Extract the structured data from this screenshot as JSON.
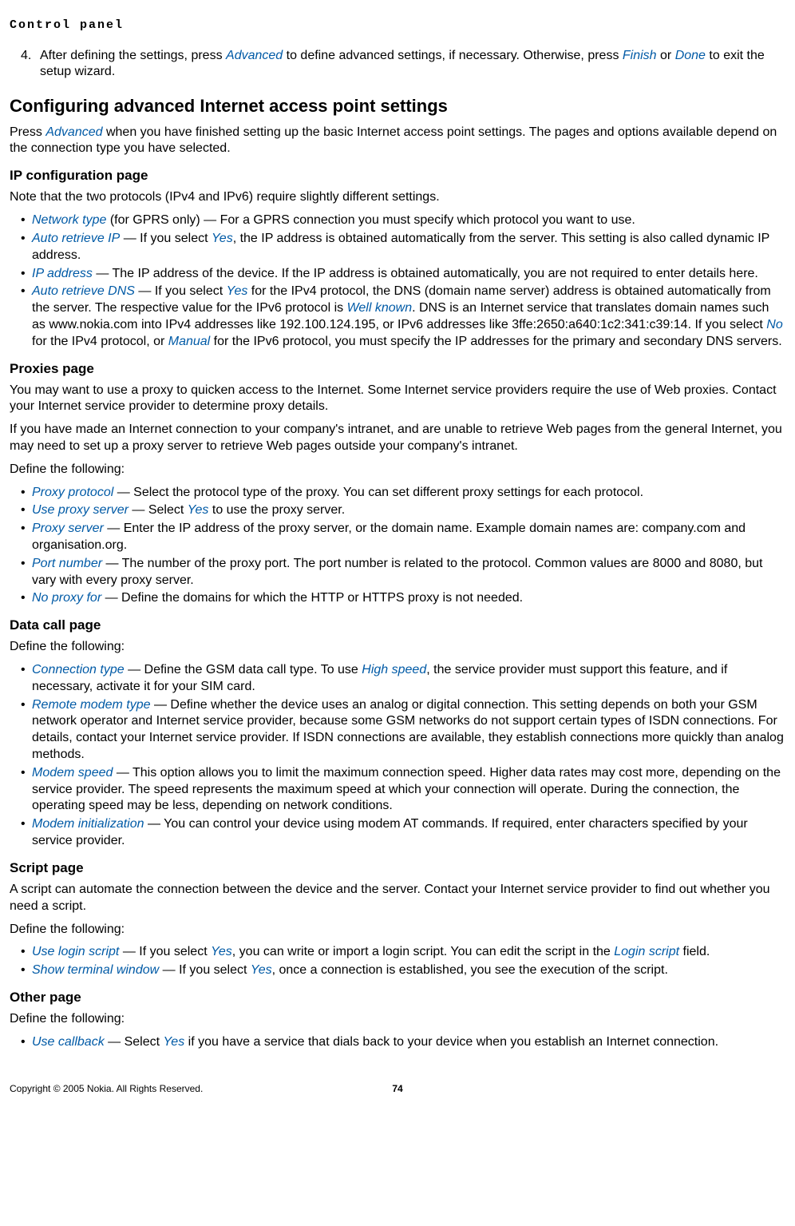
{
  "header": "Control panel",
  "step4": {
    "num": "4.",
    "t1": "After defining the settings, press ",
    "advanced": "Advanced",
    "t2": " to define advanced settings, if necessary. Otherwise, press ",
    "finish": "Finish",
    "t3": " or ",
    "done": "Done",
    "t4": " to exit the setup wizard."
  },
  "sec_config_title": "Configuring advanced Internet access point settings",
  "sec_config_intro": {
    "t1": "Press ",
    "advanced": "Advanced",
    "t2": " when you have finished setting up the basic Internet access point settings. The pages and options available depend on the connection type you have selected."
  },
  "ip_page_title": "IP configuration page",
  "ip_note": "Note that the two protocols (IPv4 and IPv6) require slightly different settings.",
  "ip_items": {
    "i1": {
      "label": "Network type",
      "text": " (for GPRS only) — For a GPRS connection you must specify which protocol you want to use."
    },
    "i2": {
      "label": "Auto retrieve IP",
      "t1": " — If you select ",
      "yes": "Yes",
      "t2": ", the IP address is obtained automatically from the server. This setting is also called dynamic IP address."
    },
    "i3": {
      "label": "IP address",
      "text": " — The IP address of the device. If the IP address is obtained automatically, you are not required to enter details here."
    },
    "i4": {
      "label": "Auto retrieve DNS",
      "t1": " — If you select ",
      "yes": "Yes",
      "t2": " for the IPv4 protocol, the DNS (domain name server) address is obtained automatically from the server. The respective value for the IPv6 protocol is ",
      "wellknown": "Well known",
      "t3": ". DNS is an Internet service that translates domain names such as www.nokia.com into IPv4 addresses like 192.100.124.195, or IPv6 addresses like 3ffe:2650:a640:1c2:341:c39:14. If you select ",
      "no": "No",
      "t4": " for the IPv4 protocol, or ",
      "manual": "Manual",
      "t5": " for the IPv6 protocol, you must specify the IP addresses for the primary and secondary DNS servers."
    }
  },
  "proxies_title": "Proxies page",
  "proxies_p1": "You may want to use a proxy to quicken access to the Internet. Some Internet service providers require the use of Web proxies. Contact your Internet service provider to determine proxy details.",
  "proxies_p2": "If you have made an Internet connection to your company's intranet, and are unable to retrieve Web pages from the general Internet, you may need to set up a proxy server to retrieve Web pages outside your company's intranet.",
  "define_following": "Define the following:",
  "prox_items": {
    "i1": {
      "label": "Proxy protocol",
      "text": " — Select the protocol type of the proxy. You can set different proxy settings for each protocol."
    },
    "i2": {
      "label": "Use proxy server",
      "t1": " — Select ",
      "yes": "Yes",
      "t2": " to use the proxy server."
    },
    "i3": {
      "label": "Proxy server",
      "text": " — Enter the IP address of the proxy server, or the domain name. Example domain names are: company.com and organisation.org."
    },
    "i4": {
      "label": "Port number",
      "text": " — The number of the proxy port. The port number is related to the protocol. Common values are 8000 and 8080, but vary with every proxy server."
    },
    "i5": {
      "label": "No proxy for",
      "text": " — Define the domains for which the HTTP or HTTPS proxy is not needed."
    }
  },
  "datacall_title": "Data call page",
  "dc_items": {
    "i1": {
      "label": "Connection type",
      "t1": " — Define the GSM data call type. To use ",
      "hs": "High speed",
      "t2": ", the service provider must support this feature, and if necessary, activate it for your SIM card."
    },
    "i2": {
      "label": "Remote modem type",
      "text": " — Define whether the device uses an analog or digital connection. This setting depends on both your GSM network operator and Internet service provider, because some GSM networks do not support certain types of ISDN connections. For details, contact your Internet service provider. If ISDN connections are available, they establish connections more quickly than analog methods."
    },
    "i3": {
      "label": "Modem speed",
      "text": " — This option allows you to limit the maximum connection speed. Higher data rates may cost more, depending on the service provider. The speed represents the maximum speed at which your connection will operate. During the connection, the operating speed may be less, depending on network conditions."
    },
    "i4": {
      "label": "Modem initialization",
      "text": " — You can control your device using modem AT commands. If required, enter characters specified by your service provider."
    }
  },
  "script_title": "Script page",
  "script_p1": "A script can automate the connection between the device and the server. Contact your Internet service provider to find out whether you need a script.",
  "script_items": {
    "i1": {
      "label": "Use login script",
      "t1": " — If you select ",
      "yes": "Yes",
      "t2": ", you can write or import a login script. You can edit the script in the ",
      "login": "Login script",
      "t3": " field."
    },
    "i2": {
      "label": "Show terminal window",
      "t1": " — If you select ",
      "yes": "Yes",
      "t2": ", once a connection is established, you see the execution of the script."
    }
  },
  "other_title": "Other page",
  "other_items": {
    "i1": {
      "label": "Use callback",
      "t1": " — Select ",
      "yes": "Yes",
      "t2": " if you have a service that dials back to your device when you establish an Internet connection."
    }
  },
  "footer": {
    "copyright": "Copyright © 2005 Nokia. All Rights Reserved.",
    "page": "74"
  }
}
